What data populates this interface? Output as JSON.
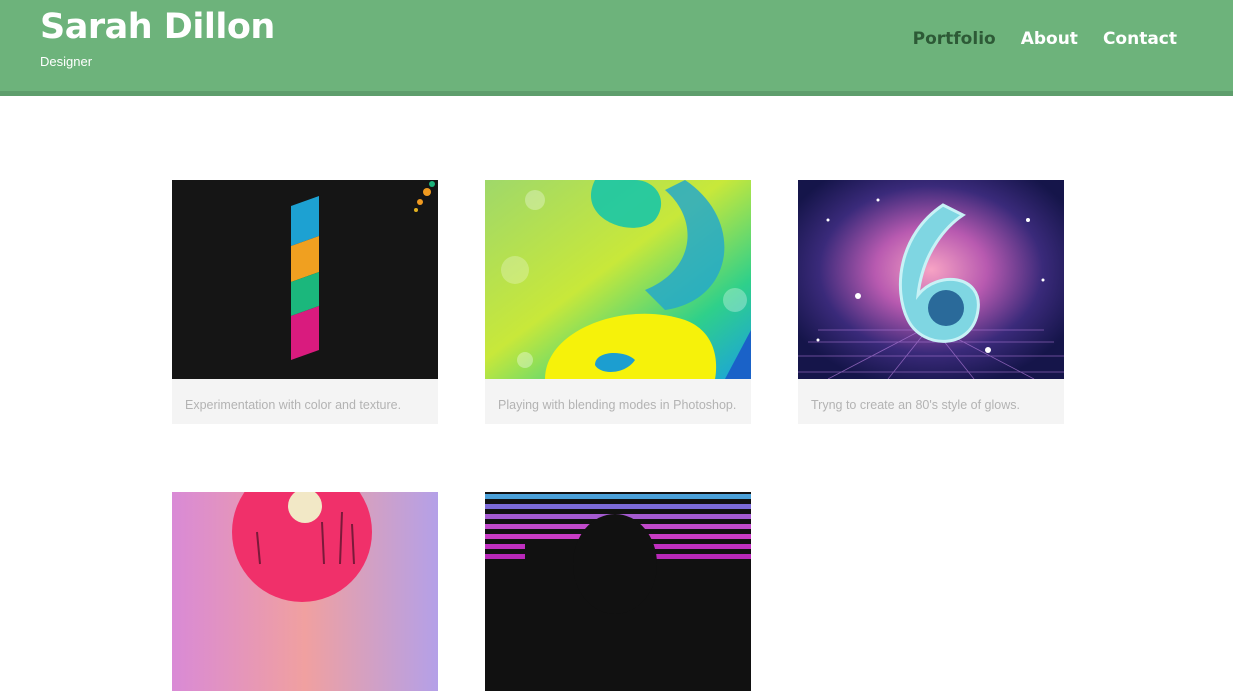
{
  "header": {
    "name": "Sarah Dillon",
    "subtitle": "Designer",
    "nav": [
      {
        "label": "Portfolio"
      },
      {
        "label": "About"
      },
      {
        "label": "Contact"
      }
    ]
  },
  "portfolio": {
    "items": [
      {
        "caption": "Experimentation with color and texture."
      },
      {
        "caption": "Playing with blending modes in Photoshop."
      },
      {
        "caption": "Tryng to create an 80's style of glows."
      },
      {
        "caption": ""
      },
      {
        "caption": ""
      }
    ]
  },
  "colors": {
    "header_bg": "#6db37b",
    "header_border": "#5e9e6c",
    "nav_active": "#2d5a36",
    "caption_bg": "#f4f4f4"
  }
}
